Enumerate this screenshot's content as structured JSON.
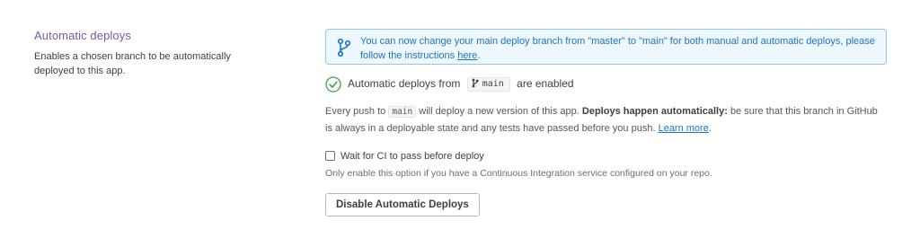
{
  "section": {
    "title": "Automatic deploys",
    "description": "Enables a chosen branch to be automatically deployed to this app."
  },
  "notice": {
    "text_before": "You can now change your main deploy branch from \"master\" to \"main\" for both manual and automatic deploys, please follow the instructions ",
    "link": "here",
    "text_after": "."
  },
  "status": {
    "prefix": "Automatic deploys from",
    "branch": "main",
    "suffix": "are enabled"
  },
  "push_info": {
    "part1": "Every push to",
    "branch": "main",
    "part2": "will deploy a new version of this app.",
    "bold": "Deploys happen automatically:",
    "part3": "be sure that this branch in GitHub is always in a deployable state and any tests have passed before you push.",
    "link": "Learn more",
    "end": "."
  },
  "ci": {
    "label": "Wait for CI to pass before deploy",
    "checked": false,
    "hint": "Only enable this option if you have a Continuous Integration service configured on your repo."
  },
  "button": {
    "label": "Disable Automatic Deploys"
  },
  "icons": {
    "notice": "git-branch-icon",
    "status": "check-circle-icon",
    "pill": "git-branch-icon"
  },
  "colors": {
    "section_title": "#79589f",
    "link": "#1a74c7",
    "notice_bg": "#eef7fd",
    "notice_border": "#8fc9f0",
    "success": "#3fa142"
  }
}
